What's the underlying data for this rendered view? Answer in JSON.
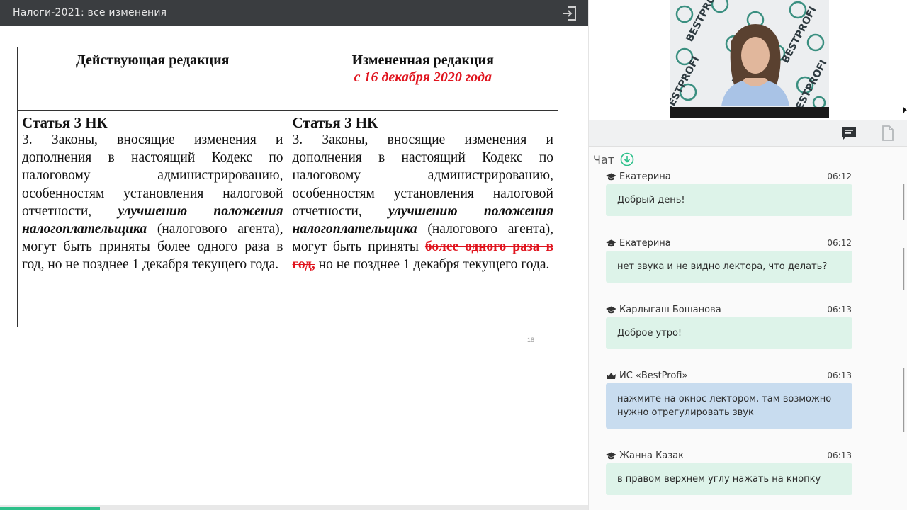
{
  "topbar": {
    "title": "Налоги-2021: все изменения"
  },
  "slide": {
    "left_header": "Действующая редакция",
    "right_header_line1": "Измененная редакция",
    "right_header_line2": "с 16 декабря 2020 года",
    "left": {
      "article": "Статья 3 НК",
      "p1": "3. Законы, вносящие изменения и дополнения в настоящий Кодекс по налоговому администрированию, особенностям установления налоговой отчетности, ",
      "p_bi": "улучшению положения налогоплательщика",
      "p2": " (налогового агента), могут быть приняты более одного раза в год, но не позднее 1 декабря текущего года."
    },
    "right": {
      "article": "Статья 3 НК",
      "p1": "3. Законы, вносящие изменения и дополнения в настоящий Кодекс по налоговому администрированию, особенностям установления налоговой отчетности, ",
      "p_bi": "улучшению положения налогоплательщика",
      "p2": " (налогового агента), могут быть приняты ",
      "p_strike": "более одного раза в год,",
      "p3": " но не позднее 1 декабря текущего года."
    },
    "page_number": "18"
  },
  "progress": {
    "fraction": 0.17
  },
  "video": {
    "brand": "BESTPROFI"
  },
  "chat": {
    "title": "Чат",
    "messages": [
      {
        "author": "Екатерина",
        "time": "06:12",
        "text": "Добрый день!",
        "role": "user"
      },
      {
        "author": "Екатерина",
        "time": "06:12",
        "text": "нет звука и не видно лектора, что делать?",
        "role": "user"
      },
      {
        "author": "Карлыгаш Бошанова",
        "time": "06:13",
        "text": "Доброе утро!",
        "role": "user"
      },
      {
        "author": "ИС «BestProfi»",
        "time": "06:13",
        "text": "нажмите на окнос лектором, там возможно нужно отрегулировать звук",
        "role": "admin"
      },
      {
        "author": "Жанна Казак",
        "time": "06:13",
        "text": "в правом верхнем углу нажать на кнопку",
        "role": "user"
      }
    ]
  },
  "colors": {
    "topbar": "#3a3d40",
    "accent_red": "#e0141e",
    "bubble_user": "#ddf3e9",
    "bubble_admin": "#c8dcef",
    "progress": "#2dc08a"
  },
  "icons": {
    "exit": "exit-icon",
    "chat_tab": "chat-icon",
    "files_tab": "document-icon",
    "download": "download-icon",
    "user_role": "graduation-cap-icon",
    "admin_role": "crown-icon"
  }
}
